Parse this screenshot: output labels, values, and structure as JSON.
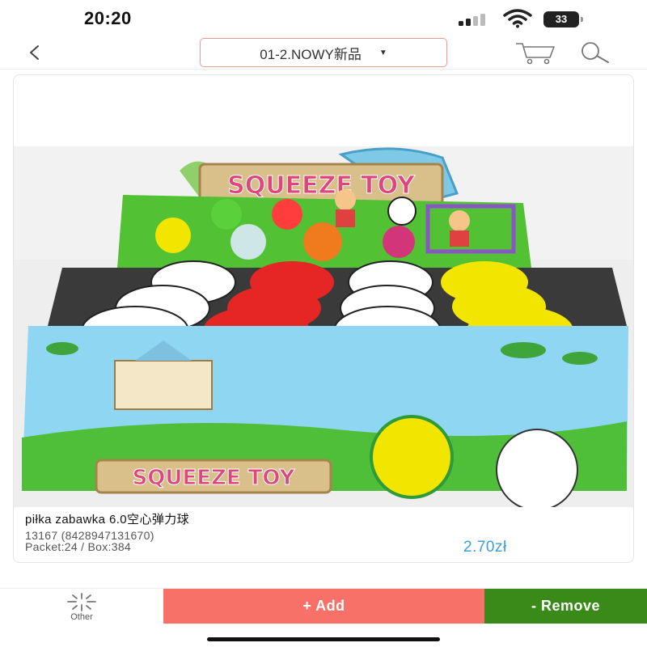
{
  "status_bar": {
    "time": "20:20",
    "battery_level": "33",
    "icons": [
      "signal-icon",
      "wifi-icon",
      "battery-icon"
    ]
  },
  "nav": {
    "back_icon": "chevron-left-icon",
    "category_label": "01-2.NOWY新品",
    "dropdown_icon": "caret-down-icon",
    "cart_icon": "cart-icon",
    "search_icon": "search-icon"
  },
  "product": {
    "image_alt": "squeeze toy balls box",
    "image_text": "SQUEEZE TOY",
    "name": "piłka  zabawka 6.0空心弹力球",
    "code": "13167 (8428947131670)",
    "packaging": "Packet:24 / Box:384",
    "price": "2.70zł"
  },
  "actions": {
    "other_label": "Other",
    "other_icon": "sparkle-icon",
    "add_label": "+ Add",
    "remove_label": "- Remove"
  },
  "colors": {
    "accent_price": "#3aa0de",
    "add_button": "#f87168",
    "remove_button": "#3a8a1a",
    "dropdown_border": "#f09a8e"
  }
}
